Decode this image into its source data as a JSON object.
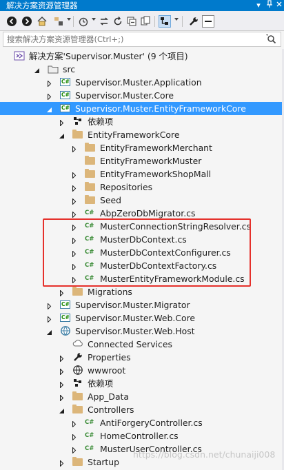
{
  "window": {
    "title": "解决方案资源管理器",
    "pin_glyph": "⊞",
    "dropdown_glyph": "▾"
  },
  "search": {
    "placeholder": "搜索解决方案资源管理器(Ctrl+;)"
  },
  "tree": {
    "rows": [
      {
        "label": "解决方案'Supervisor.Muster' (9 个项目)",
        "icon": "solution-icon",
        "expander": "none",
        "indent": 0
      },
      {
        "label": "src",
        "icon": "solution-folder-icon",
        "expander": "expanded",
        "indent": 1
      },
      {
        "label": "Supervisor.Muster.Application",
        "icon": "csproj-icon",
        "expander": "collapsed",
        "indent": 2
      },
      {
        "label": "Supervisor.Muster.Core",
        "icon": "csproj-icon",
        "expander": "collapsed",
        "indent": 2
      },
      {
        "label": "Supervisor.Muster.EntityFrameworkCore",
        "icon": "csproj-icon",
        "expander": "expanded",
        "indent": 2,
        "selected": true
      },
      {
        "label": "依赖项",
        "icon": "dependencies-icon",
        "expander": "collapsed",
        "indent": 3
      },
      {
        "label": "EntityFrameworkCore",
        "icon": "folder-icon",
        "expander": "expanded",
        "indent": 3
      },
      {
        "label": "EntityFrameworkMerchant",
        "icon": "folder-icon",
        "expander": "collapsed",
        "indent": 4
      },
      {
        "label": "EntityFrameworkMuster",
        "icon": "folder-icon",
        "expander": "none",
        "indent": 4
      },
      {
        "label": "EntityFrameworkShopMall",
        "icon": "folder-icon",
        "expander": "collapsed",
        "indent": 4
      },
      {
        "label": "Repositories",
        "icon": "folder-icon",
        "expander": "collapsed",
        "indent": 4
      },
      {
        "label": "Seed",
        "icon": "folder-icon",
        "expander": "collapsed",
        "indent": 4
      },
      {
        "label": "AbpZeroDbMigrator.cs",
        "icon": "csharp-file-icon",
        "expander": "collapsed",
        "indent": 4
      },
      {
        "label": "MusterConnectionStringResolver.cs",
        "icon": "csharp-file-icon",
        "expander": "collapsed",
        "indent": 4
      },
      {
        "label": "MusterDbContext.cs",
        "icon": "csharp-file-icon",
        "expander": "collapsed",
        "indent": 4
      },
      {
        "label": "MusterDbContextConfigurer.cs",
        "icon": "csharp-file-icon",
        "expander": "collapsed",
        "indent": 4
      },
      {
        "label": "MusterDbContextFactory.cs",
        "icon": "csharp-file-icon",
        "expander": "collapsed",
        "indent": 4
      },
      {
        "label": "MusterEntityFrameworkModule.cs",
        "icon": "csharp-file-icon",
        "expander": "collapsed",
        "indent": 4
      },
      {
        "label": "Migrations",
        "icon": "folder-icon",
        "expander": "collapsed",
        "indent": 3
      },
      {
        "label": "Supervisor.Muster.Migrator",
        "icon": "csproj-icon",
        "expander": "collapsed",
        "indent": 2
      },
      {
        "label": "Supervisor.Muster.Web.Core",
        "icon": "csproj-icon",
        "expander": "collapsed",
        "indent": 2
      },
      {
        "label": "Supervisor.Muster.Web.Host",
        "icon": "web-project-icon",
        "expander": "expanded",
        "indent": 2
      },
      {
        "label": "Connected Services",
        "icon": "connected-services-icon",
        "expander": "none",
        "indent": 3
      },
      {
        "label": "Properties",
        "icon": "wrench-icon",
        "expander": "collapsed",
        "indent": 3
      },
      {
        "label": "wwwroot",
        "icon": "globe-icon",
        "expander": "collapsed",
        "indent": 3
      },
      {
        "label": "依赖项",
        "icon": "dependencies-icon",
        "expander": "collapsed",
        "indent": 3
      },
      {
        "label": "App_Data",
        "icon": "folder-icon",
        "expander": "collapsed",
        "indent": 3
      },
      {
        "label": "Controllers",
        "icon": "folder-icon",
        "expander": "expanded",
        "indent": 3
      },
      {
        "label": "AntiForgeryController.cs",
        "icon": "csharp-file-icon",
        "expander": "collapsed",
        "indent": 4
      },
      {
        "label": "HomeController.cs",
        "icon": "csharp-file-icon",
        "expander": "collapsed",
        "indent": 4
      },
      {
        "label": "MusterUserController.cs",
        "icon": "csharp-file-icon",
        "expander": "collapsed",
        "indent": 4
      },
      {
        "label": "Startup",
        "icon": "folder-icon",
        "expander": "collapsed",
        "indent": 3
      }
    ]
  },
  "watermark": "https://blog.csdn.net/chunaiji008",
  "colors": {
    "accent": "#007acc",
    "selection": "#3399ff",
    "highlight_box": "#e5302b",
    "csharp_green": "#388a34",
    "folder": "#dcb67a"
  }
}
